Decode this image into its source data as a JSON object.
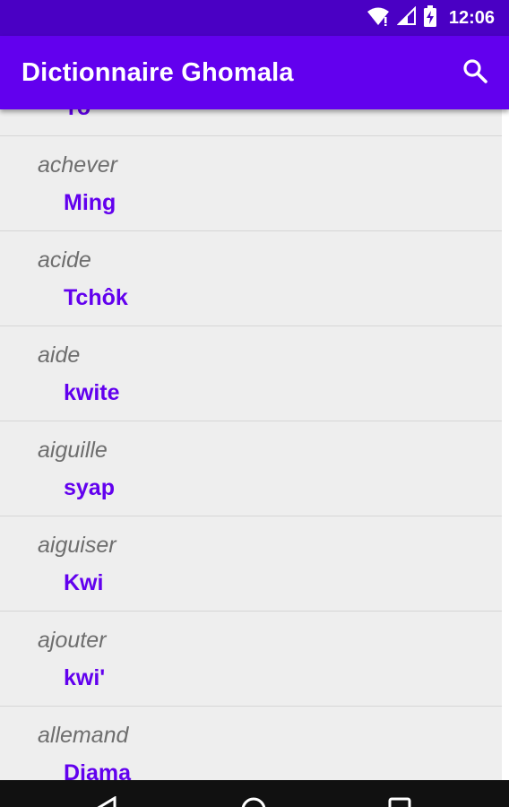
{
  "status_bar": {
    "time": "12:06",
    "icons": [
      "wifi-icon",
      "signal-icon",
      "battery-charging-icon"
    ]
  },
  "app_bar": {
    "title": "Dictionnaire Ghomala",
    "search_icon": "search-icon"
  },
  "entries": [
    {
      "fr": "",
      "gh": "Yo"
    },
    {
      "fr": "achever",
      "gh": "Ming"
    },
    {
      "fr": "acide",
      "gh": "Tchôk"
    },
    {
      "fr": "aide",
      "gh": "kwite"
    },
    {
      "fr": "aiguille",
      "gh": "syap"
    },
    {
      "fr": "aiguiser",
      "gh": "Kwi"
    },
    {
      "fr": "ajouter",
      "gh": "kwi'"
    },
    {
      "fr": "allemand",
      "gh": "Djama"
    }
  ],
  "nav_bar": {
    "icons": [
      "back-icon",
      "home-icon",
      "recents-icon"
    ]
  },
  "colors": {
    "status_bar": "#4a00c4",
    "app_bar": "#6200ee",
    "accent": "#6200ee",
    "list_background": "#eeeeee",
    "french_text": "#6e6e6e"
  }
}
